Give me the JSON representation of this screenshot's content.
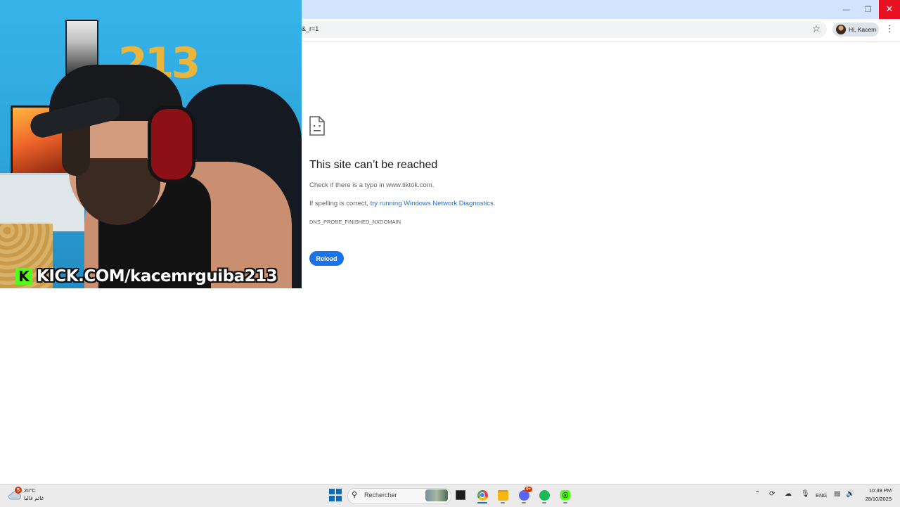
{
  "browser": {
    "address_text": "&_r=1",
    "profile_label": "Hi, Kacem",
    "icons": {
      "bookmark": "star-icon",
      "menu": "more-vertical-icon",
      "minimize": "minimize-icon",
      "restore": "restore-icon",
      "close": "close-icon"
    }
  },
  "error_page": {
    "title": "This site can’t be reached",
    "typo_text": "Check if there is a typo in www.tiktok.com.",
    "spelling_prefix": "If spelling is correct, ",
    "diagnostics_link": "try running Windows Network Diagnostics",
    "spelling_suffix": ".",
    "error_code": "DNS_PROBE_FINISHED_NXDOMAIN",
    "reload_label": "Reload",
    "link_color": "#1a73e8"
  },
  "webcam": {
    "banner_k": "K",
    "banner_text": "KICK.COM/kacemrguiba213",
    "balloon_number": "213",
    "kick_color": "#53fc18"
  },
  "taskbar": {
    "weather_badge": "5",
    "weather_temp": "20°C",
    "weather_desc": "غائم غالبا",
    "search_placeholder": "Rechercher",
    "discord_badge": "9+",
    "kick_app_label": "ⓚ",
    "language": "ENG",
    "time": "10:39 PM",
    "date": "28/10/2025",
    "apps": [
      "task-view",
      "chrome",
      "file-explorer",
      "discord",
      "spotify",
      "kick"
    ]
  }
}
